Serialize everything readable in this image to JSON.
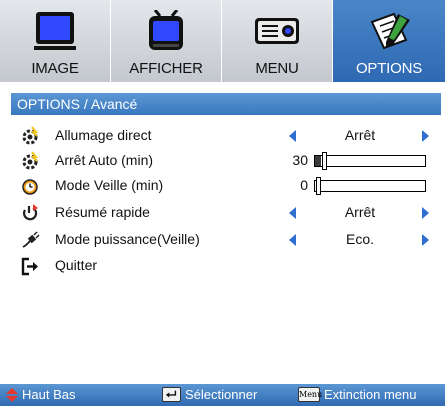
{
  "tabs": [
    {
      "label": "IMAGE",
      "icon": "monitor-icon",
      "active": false
    },
    {
      "label": "AFFICHER",
      "icon": "tv-icon",
      "active": false
    },
    {
      "label": "MENU",
      "icon": "projector-icon",
      "active": false
    },
    {
      "label": "OPTIONS",
      "icon": "notepad-pen-icon",
      "active": true
    }
  ],
  "section_title": "OPTIONS / Avancé",
  "rows": [
    {
      "label": "Allumage direct",
      "icon": "gear-spark-icon",
      "control": "selector",
      "value": "Arrêt"
    },
    {
      "label": "Arrêt Auto (min)",
      "icon": "gear-spark-icon",
      "control": "slider",
      "value": "30",
      "level": 0.05
    },
    {
      "label": "Mode Veille (min)",
      "icon": "clock-icon",
      "control": "slider",
      "value": "0",
      "level": 0.0
    },
    {
      "label": "Résumé rapide",
      "icon": "power-arrow-icon",
      "control": "selector",
      "value": "Arrêt"
    },
    {
      "label": "Mode puissance(Veille)",
      "icon": "plug-icon",
      "control": "selector",
      "value": "Eco."
    },
    {
      "label": "Quitter",
      "icon": "exit-icon",
      "control": "none",
      "value": ""
    }
  ],
  "footer": {
    "nav_label": "Haut Bas",
    "select_label": "Sélectionner",
    "menu_key_label": "Menu",
    "exit_label": "Extinction menu"
  },
  "colors": {
    "accent": "#3a78bf",
    "arrow": "#2f6fd0",
    "tab_active": "#2e69b3",
    "footer_icon": "#e8382b"
  }
}
